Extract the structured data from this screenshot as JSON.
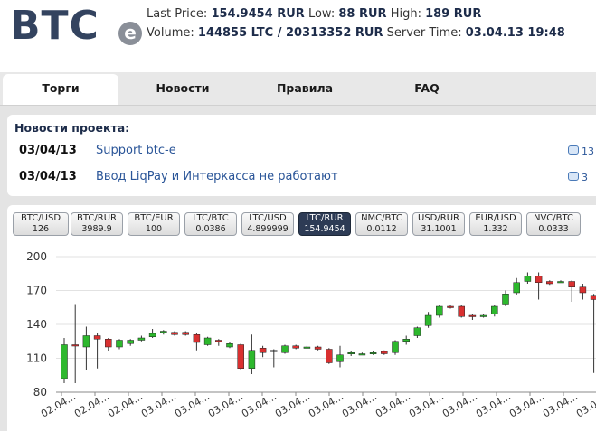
{
  "logo": {
    "text": "BTC",
    "suffix": "e"
  },
  "ticker": {
    "last_price_label": "Last Price:",
    "last_price": "154.9454 RUR",
    "low_label": "Low:",
    "low": "88 RUR",
    "high_label": "High:",
    "high": "189 RUR",
    "volume_label": "Volume:",
    "volume": "144855 LTC / 20313352 RUR",
    "server_time_label": "Server Time:",
    "server_time": "03.04.13 19:48"
  },
  "nav": {
    "tabs": [
      {
        "label": "Торги",
        "active": true
      },
      {
        "label": "Новости",
        "active": false
      },
      {
        "label": "Правила",
        "active": false
      },
      {
        "label": "FAQ",
        "active": false
      }
    ]
  },
  "news": {
    "title": "Новости проекта:",
    "items": [
      {
        "date": "03/04/13",
        "text": "Support btc-e",
        "comments": "13"
      },
      {
        "date": "03/04/13",
        "text": "Ввод LiqPay и Интеркасса не работают",
        "comments": "3"
      }
    ]
  },
  "pairs": [
    {
      "name": "BTC/USD",
      "value": "126"
    },
    {
      "name": "BTC/RUR",
      "value": "3989.9"
    },
    {
      "name": "BTC/EUR",
      "value": "100"
    },
    {
      "name": "LTC/BTC",
      "value": "0.0386"
    },
    {
      "name": "LTC/USD",
      "value": "4.899999"
    },
    {
      "name": "LTC/RUR",
      "value": "154.9454",
      "selected": true
    },
    {
      "name": "NMC/BTC",
      "value": "0.0112"
    },
    {
      "name": "USD/RUR",
      "value": "31.1001"
    },
    {
      "name": "EUR/USD",
      "value": "1.332"
    },
    {
      "name": "NVC/BTC",
      "value": "0.0333"
    }
  ],
  "chart_data": {
    "type": "candlestick",
    "ylim": [
      80,
      200
    ],
    "yticks": [
      80,
      110,
      140,
      170,
      200
    ],
    "xtick_labels": [
      "02.04...",
      "02.04...",
      "02.04...",
      "03.04...",
      "03.04...",
      "03.04...",
      "03.04...",
      "03.04...",
      "03.04...",
      "03.04...",
      "03.04...",
      "03.04...",
      "03.04...",
      "03.04...",
      "03.04...",
      "03.04...",
      "03.04..."
    ],
    "up_color": "#2db82d",
    "down_color": "#d93030",
    "candles": [
      {
        "o": 92,
        "c": 122,
        "l": 88,
        "h": 128
      },
      {
        "o": 122,
        "c": 121,
        "l": 88,
        "h": 158
      },
      {
        "o": 120,
        "c": 130,
        "l": 100,
        "h": 138
      },
      {
        "o": 130,
        "c": 127,
        "l": 101,
        "h": 132
      },
      {
        "o": 127,
        "c": 120,
        "l": 116,
        "h": 128
      },
      {
        "o": 120,
        "c": 126,
        "l": 118,
        "h": 127
      },
      {
        "o": 123,
        "c": 126,
        "l": 121,
        "h": 127
      },
      {
        "o": 126,
        "c": 128,
        "l": 125,
        "h": 130
      },
      {
        "o": 129,
        "c": 132,
        "l": 128,
        "h": 136
      },
      {
        "o": 133,
        "c": 134,
        "l": 131,
        "h": 135
      },
      {
        "o": 133,
        "c": 131,
        "l": 130,
        "h": 134
      },
      {
        "o": 133,
        "c": 131,
        "l": 130,
        "h": 134
      },
      {
        "o": 131,
        "c": 124,
        "l": 117,
        "h": 132
      },
      {
        "o": 122,
        "c": 128,
        "l": 121,
        "h": 129
      },
      {
        "o": 126,
        "c": 125,
        "l": 121,
        "h": 127
      },
      {
        "o": 120,
        "c": 123,
        "l": 119,
        "h": 124
      },
      {
        "o": 122,
        "c": 101,
        "l": 100,
        "h": 123
      },
      {
        "o": 101,
        "c": 117,
        "l": 96,
        "h": 131
      },
      {
        "o": 119,
        "c": 115,
        "l": 111,
        "h": 121
      },
      {
        "o": 117,
        "c": 116,
        "l": 102,
        "h": 118
      },
      {
        "o": 115,
        "c": 121,
        "l": 114,
        "h": 122
      },
      {
        "o": 121,
        "c": 119,
        "l": 118,
        "h": 122
      },
      {
        "o": 120,
        "c": 120,
        "l": 119,
        "h": 121
      },
      {
        "o": 120,
        "c": 118,
        "l": 117,
        "h": 121
      },
      {
        "o": 118,
        "c": 106,
        "l": 105,
        "h": 119
      },
      {
        "o": 107,
        "c": 113,
        "l": 102,
        "h": 121
      },
      {
        "o": 114,
        "c": 115,
        "l": 112,
        "h": 116
      },
      {
        "o": 114,
        "c": 114,
        "l": 113,
        "h": 115
      },
      {
        "o": 114,
        "c": 115,
        "l": 113,
        "h": 116
      },
      {
        "o": 116,
        "c": 114,
        "l": 113,
        "h": 117
      },
      {
        "o": 115,
        "c": 125,
        "l": 113,
        "h": 126
      },
      {
        "o": 125,
        "c": 127,
        "l": 122,
        "h": 130
      },
      {
        "o": 130,
        "c": 137,
        "l": 128,
        "h": 138
      },
      {
        "o": 139,
        "c": 148,
        "l": 137,
        "h": 151
      },
      {
        "o": 148,
        "c": 156,
        "l": 146,
        "h": 157
      },
      {
        "o": 156,
        "c": 155,
        "l": 154,
        "h": 157
      },
      {
        "o": 156,
        "c": 147,
        "l": 146,
        "h": 157
      },
      {
        "o": 148,
        "c": 147,
        "l": 144,
        "h": 149
      },
      {
        "o": 147,
        "c": 148,
        "l": 146,
        "h": 149
      },
      {
        "o": 149,
        "c": 156,
        "l": 147,
        "h": 157
      },
      {
        "o": 158,
        "c": 167,
        "l": 156,
        "h": 170
      },
      {
        "o": 168,
        "c": 177,
        "l": 166,
        "h": 181
      },
      {
        "o": 178,
        "c": 183,
        "l": 176,
        "h": 186
      },
      {
        "o": 183,
        "c": 177,
        "l": 162,
        "h": 186
      },
      {
        "o": 178,
        "c": 176,
        "l": 175,
        "h": 179
      },
      {
        "o": 178,
        "c": 178,
        "l": 177,
        "h": 179
      },
      {
        "o": 178,
        "c": 173,
        "l": 160,
        "h": 179
      },
      {
        "o": 173,
        "c": 168,
        "l": 162,
        "h": 176
      },
      {
        "o": 165,
        "c": 162,
        "l": 97,
        "h": 167
      },
      {
        "o": 158,
        "c": 155,
        "l": 148,
        "h": 159
      }
    ]
  }
}
